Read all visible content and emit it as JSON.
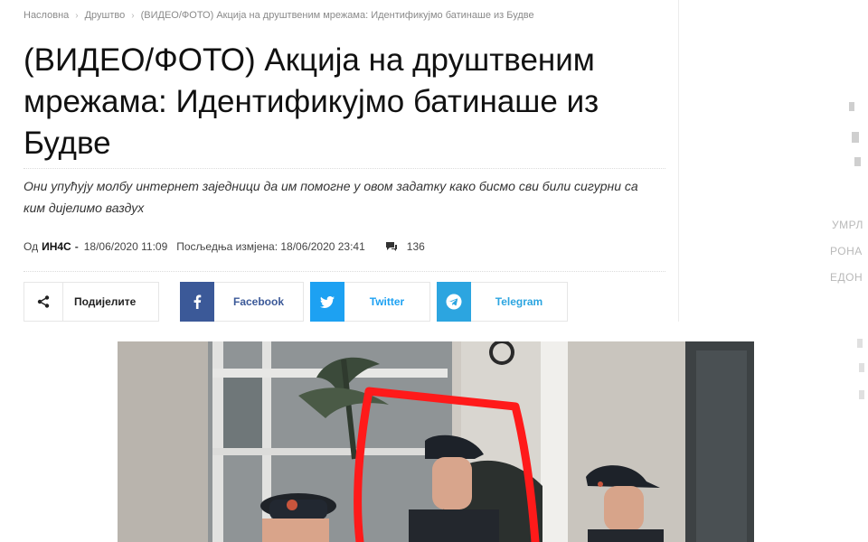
{
  "breadcrumb": {
    "home": "Насловна",
    "section": "Друштво",
    "current": "(ВИДЕО/ФОТО) Акција на друштвеним мрежама: Идентификујмо батинаше из Будве"
  },
  "article": {
    "title": "(ВИДЕО/ФОТО) Акција на друштвеним мрежама: Идентификујмо батинаше из Будве",
    "excerpt": "Они упућују молбу интернет заједници да им помогне у овом задатку како бисмо сви били сигурни са ким дијелимо ваздух",
    "by_label": "Од",
    "author": "ИН4С",
    "dash": "-",
    "published": "18/06/2020 11:09",
    "updated": "Посљедња измјена: 18/06/2020 23:41",
    "comments_count": "136"
  },
  "share": {
    "label": "Подијелите",
    "facebook": "Facebook",
    "twitter": "Twitter",
    "telegram": "Telegram"
  },
  "sidebar_fragments": [
    "УМРЛ",
    "РОНА",
    "ЕДОН"
  ],
  "colors": {
    "facebook": "#3b5998",
    "twitter": "#1da1f2",
    "telegram": "#2ca5e0",
    "marker": "#ff1a1a"
  }
}
